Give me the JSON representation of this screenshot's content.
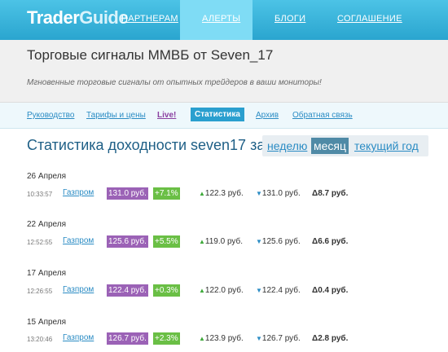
{
  "logo": {
    "part1": "Trader",
    "part2": "Guide"
  },
  "nav": [
    "ПАРТНЕРАМ",
    "АЛЕРТЫ",
    "БЛОГИ",
    "СОГЛАШЕНИЕ"
  ],
  "header": {
    "title": "Торговые сигналы ММВБ от Seven_17",
    "subtitle": "Мгновенные торговые сигналы от опытных трейдеров в ваши мониторы!"
  },
  "subnav": [
    "Руководство",
    "Тарифы и цены",
    "Live!",
    "Статистика",
    "Архив",
    "Обратная связь"
  ],
  "stats": {
    "title": "Статистика доходности seven17 за",
    "periods": [
      "неделю",
      "месяц",
      "текущий год"
    ],
    "selected": "месяц"
  },
  "entries": [
    {
      "date": "26 Апреля",
      "time": "10:33:57",
      "ticker": "Газпром",
      "price": "131.0 руб.",
      "change": "+7.1%",
      "high": "122.3 руб.",
      "low": "131.0 руб.",
      "delta": "Δ8.7 руб."
    },
    {
      "date": "22 Апреля",
      "time": "12:52:55",
      "ticker": "Газпром",
      "price": "125.6 руб.",
      "change": "+5.5%",
      "high": "119.0 руб.",
      "low": "125.6 руб.",
      "delta": "Δ6.6 руб."
    },
    {
      "date": "17 Апреля",
      "time": "12:26:55",
      "ticker": "Газпром",
      "price": "122.4 руб.",
      "change": "+0.3%",
      "high": "122.0 руб.",
      "low": "122.4 руб.",
      "delta": "Δ0.4 руб."
    },
    {
      "date": "15 Апреля",
      "time": "13:20:46",
      "ticker": "Газпром",
      "price": "126.7 руб.",
      "change": "+2.3%",
      "high": "123.9 руб.",
      "low": "126.7 руб.",
      "delta": "Δ2.8 руб."
    }
  ]
}
